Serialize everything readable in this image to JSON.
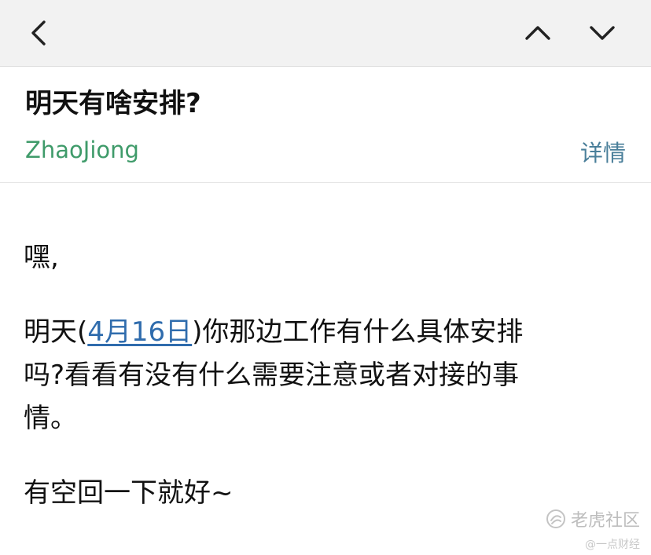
{
  "nav": {
    "back_icon": "chevron-left-icon",
    "prev_icon": "chevron-up-icon",
    "next_icon": "chevron-down-icon",
    "icon_color": "#222222"
  },
  "email": {
    "subject": "明天有啥安排?",
    "sender": "ZhaoJiong",
    "details_label": "详情",
    "greeting": "嘿,",
    "line1_prefix": "明天(",
    "date_link": "4月16日",
    "line1_suffix": ")你那边工作有什么具体安排",
    "line2": "吗?看看有没有什么需要注意或者对接的事",
    "line3": "情。",
    "signoff": "有空回一下就好~"
  },
  "colors": {
    "sender": "#3f9b6a",
    "details": "#4a7f9a",
    "link": "#2f6cad",
    "topbar": "#f2f2f2"
  },
  "watermark": {
    "name": "老虎社区",
    "sub": "@一点财经"
  }
}
